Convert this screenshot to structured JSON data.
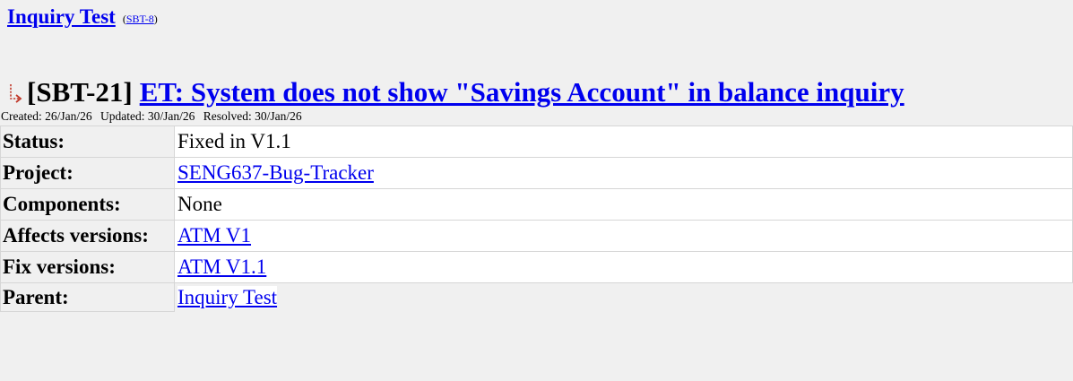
{
  "parent": {
    "title": "Inquiry Test",
    "key_open": "(",
    "key": "SBT-8",
    "key_close": ")"
  },
  "issue": {
    "icon": "subtask-icon",
    "key": "[SBT-21]",
    "summary": "ET: System does not show \"Savings Account\" in balance inquiry"
  },
  "dates": {
    "created": "Created: 26/Jan/26",
    "updated": "Updated: 30/Jan/26",
    "resolved": "Resolved: 30/Jan/26"
  },
  "fields": [
    {
      "label": "Status:",
      "value": "Fixed in V1.1"
    },
    {
      "label": "Project:",
      "value": "SENG637-Bug-Tracker"
    },
    {
      "label": "Components:",
      "value": "None"
    },
    {
      "label": "Affects versions:",
      "value": "ATM V1"
    },
    {
      "label": "Fix versions:",
      "value": "ATM V1.1"
    },
    {
      "label": "Parent:",
      "value": "Inquiry Test"
    }
  ],
  "colors": {
    "link": "#0000ee",
    "background": "#f0f0f0",
    "value_cell": "#ffffff",
    "icon": "#c0392b"
  }
}
